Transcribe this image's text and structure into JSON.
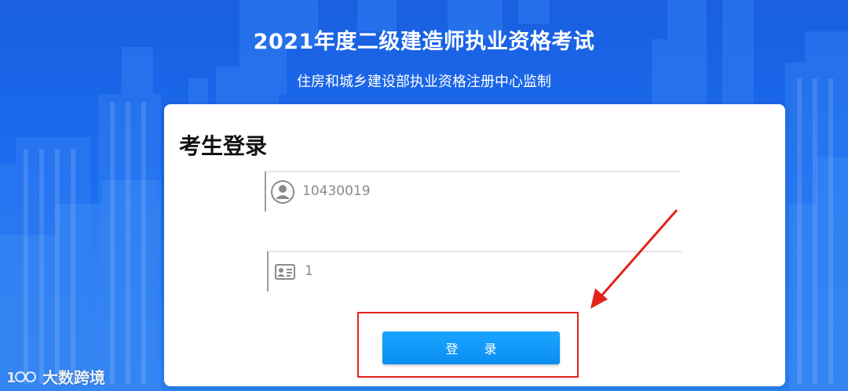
{
  "header": {
    "title": "2021年度二级建造师执业资格考试",
    "subtitle": "住房和城乡建设部执业资格注册中心监制"
  },
  "login": {
    "title": "考生登录",
    "username_value": "10430019",
    "username_icon": "user-avatar-icon",
    "id_value": "1",
    "id_icon": "id-card-icon",
    "button_label": "登 录"
  },
  "watermark": {
    "text": "大数跨境"
  },
  "colors": {
    "background": "#1b6cf0",
    "button": "#0a8ff2",
    "annotation": "#e3231c"
  }
}
